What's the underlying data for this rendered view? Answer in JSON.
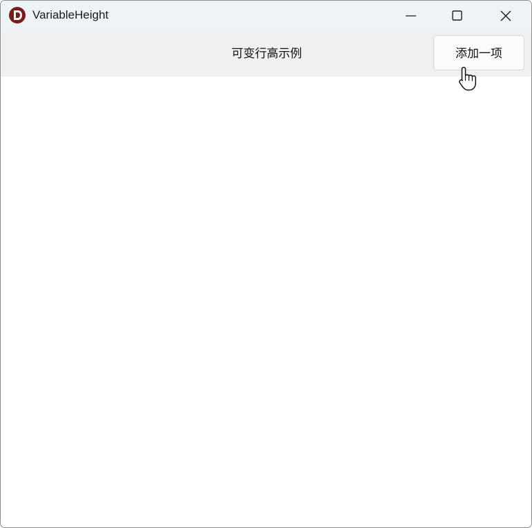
{
  "window": {
    "title": "VariableHeight",
    "app_icon": "app-logo-icon",
    "controls": [
      "minimize-icon",
      "maximize-icon",
      "close-icon"
    ]
  },
  "toolbar": {
    "title": "可变行高示例",
    "add_button_label": "添加一项"
  },
  "list": {
    "items": []
  },
  "colors": {
    "titlebar": "#eef3f8",
    "toolbar": "#f0f0f0",
    "app_icon": "#7a1c1c"
  }
}
